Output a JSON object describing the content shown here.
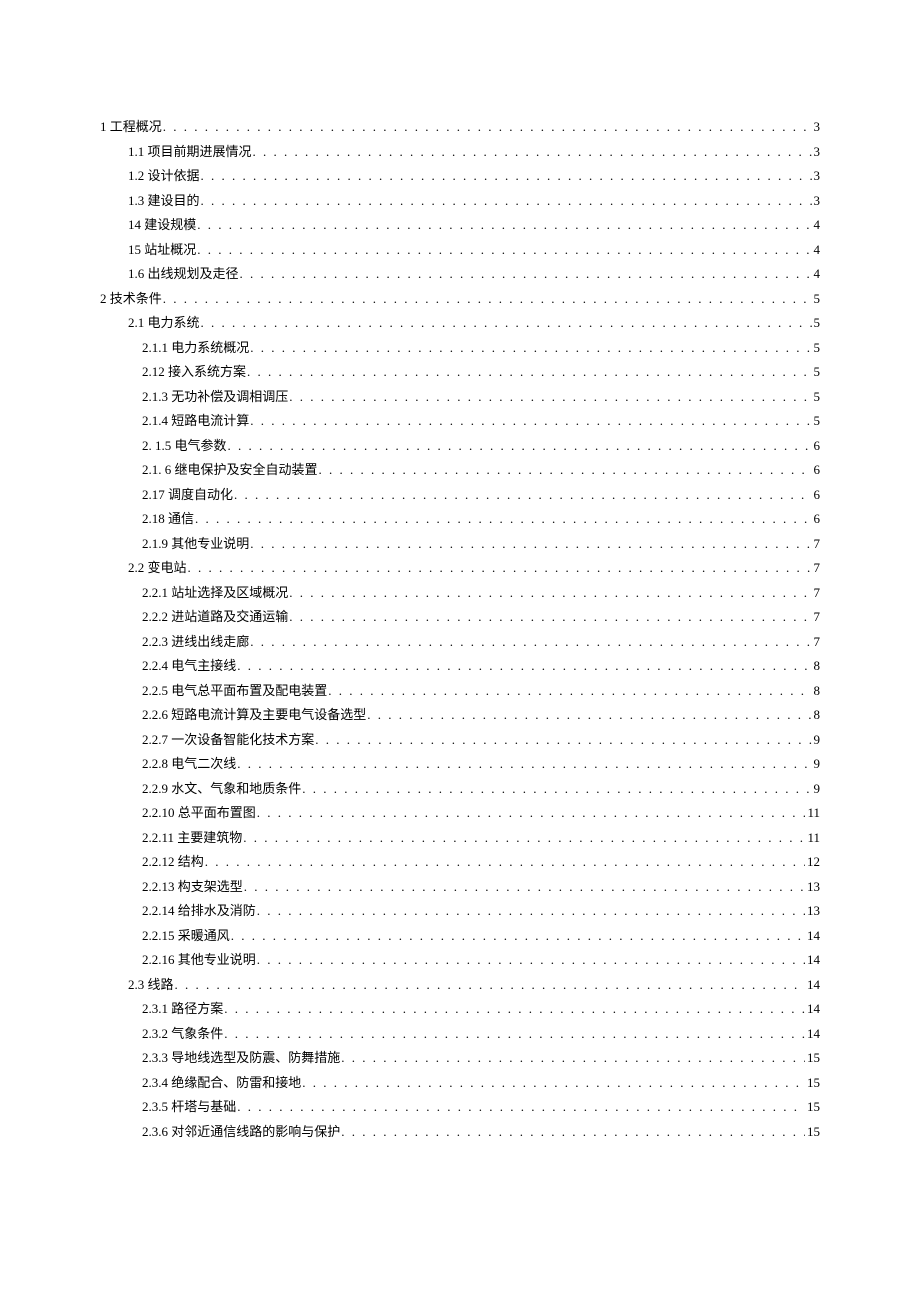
{
  "toc": [
    {
      "level": 0,
      "label": "1 工程概况",
      "page": "3"
    },
    {
      "level": 1,
      "label": "1.1   项目前期进展情况",
      "page": "3"
    },
    {
      "level": 1,
      "label": "1.2   设计依据",
      "page": "3"
    },
    {
      "level": 1,
      "label": "1.3   建设目的",
      "page": "3"
    },
    {
      "level": 1,
      "label": "14 建设规模",
      "page": "4"
    },
    {
      "level": 1,
      "label": "15 站址概况",
      "page": "4"
    },
    {
      "level": 1,
      "label": "1.6 出线规划及走径",
      "page": "4"
    },
    {
      "level": 0,
      "label": "2 技术条件",
      "page": "5"
    },
    {
      "level": 1,
      "label": "2.1 电力系统",
      "page": "5"
    },
    {
      "level": 2,
      "label": "2.1.1 电力系统概况",
      "page": "5"
    },
    {
      "level": 2,
      "label": "2.12 接入系统方案",
      "page": "5"
    },
    {
      "level": 2,
      "label": "2.1.3 无功补偿及调相调压",
      "page": "5"
    },
    {
      "level": 2,
      "label": "2.1.4 短路电流计算",
      "page": "5"
    },
    {
      "level": 2,
      "label": "2.  1.5 电气参数",
      "page": "6"
    },
    {
      "level": 2,
      "label": "2.1.   6 继电保护及安全自动装置",
      "page": "6"
    },
    {
      "level": 2,
      "label": "2.17 调度自动化",
      "page": "6"
    },
    {
      "level": 2,
      "label": "2.18 通信",
      "page": "6"
    },
    {
      "level": 2,
      "label": "2.1.9 其他专业说明",
      "page": "7"
    },
    {
      "level": 1,
      "label": "2.2 变电站",
      "page": "7"
    },
    {
      "level": 2,
      "label": "2.2.1 站址选择及区域概况",
      "page": "7"
    },
    {
      "level": 2,
      "label": "2.2.2 进站道路及交通运输",
      "page": "7"
    },
    {
      "level": 2,
      "label": "2.2.3 进线出线走廊",
      "page": "7"
    },
    {
      "level": 2,
      "label": "2.2.4 电气主接线",
      "page": "8"
    },
    {
      "level": 2,
      "label": "2.2.5 电气总平面布置及配电装置",
      "page": "8"
    },
    {
      "level": 2,
      "label": "2.2.6 短路电流计算及主要电气设备选型",
      "page": "8"
    },
    {
      "level": 2,
      "label": "2.2.7 一次设备智能化技术方案",
      "page": "9"
    },
    {
      "level": 2,
      "label": "2.2.8 电气二次线",
      "page": "9"
    },
    {
      "level": 2,
      "label": "2.2.9 水文、气象和地质条件",
      "page": "9"
    },
    {
      "level": 2,
      "label": "2.2.10 总平面布置图",
      "page": "11"
    },
    {
      "level": 2,
      "label": "2.2.11 主要建筑物",
      "page": "11"
    },
    {
      "level": 2,
      "label": "2.2.12 结构",
      "page": "12"
    },
    {
      "level": 2,
      "label": "2.2.13 构支架选型",
      "page": "13"
    },
    {
      "level": 2,
      "label": "2.2.14 给排水及消防",
      "page": "13"
    },
    {
      "level": 2,
      "label": "2.2.15 采暖通风",
      "page": "14"
    },
    {
      "level": 2,
      "label": "2.2.16 其他专业说明",
      "page": "14"
    },
    {
      "level": 1,
      "label": "2.3 线路",
      "page": "14"
    },
    {
      "level": 2,
      "label": "2.3.1 路径方案",
      "page": "14"
    },
    {
      "level": 2,
      "label": "2.3.2 气象条件",
      "page": "14"
    },
    {
      "level": 2,
      "label": "2.3.3 导地线选型及防震、防舞措施",
      "page": "15"
    },
    {
      "level": 2,
      "label": "2.3.4 绝缘配合、防雷和接地",
      "page": "15"
    },
    {
      "level": 2,
      "label": "2.3.5 杆塔与基础",
      "page": "15"
    },
    {
      "level": 2,
      "label": "2.3.6 对邻近通信线路的影响与保护",
      "page": "15"
    }
  ]
}
